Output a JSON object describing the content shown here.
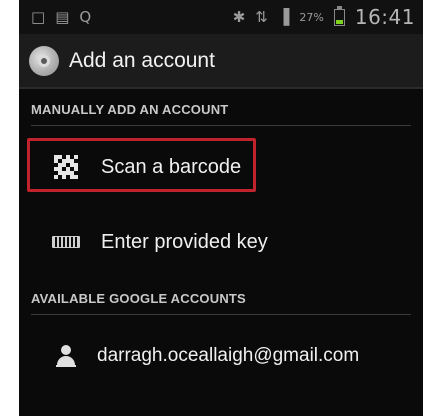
{
  "status_bar": {
    "time": "16:41",
    "battery_percent": "27%",
    "battery_level": 0.27,
    "left_icons": [
      "notification-icon",
      "gallery-icon",
      "search-icon"
    ],
    "right_icons": [
      "bluetooth-icon",
      "data-icon",
      "signal-icon"
    ],
    "battery_color": "#7ed321"
  },
  "title_bar": {
    "title": "Add an account"
  },
  "sections": {
    "manual": {
      "header": "MANUALLY ADD AN ACCOUNT",
      "scan_label": "Scan a barcode",
      "enter_key_label": "Enter provided key"
    },
    "google": {
      "header": "AVAILABLE GOOGLE ACCOUNTS",
      "account_email": "darragh.oceallaigh@gmail.com"
    }
  },
  "highlight_color": "#c0232b"
}
